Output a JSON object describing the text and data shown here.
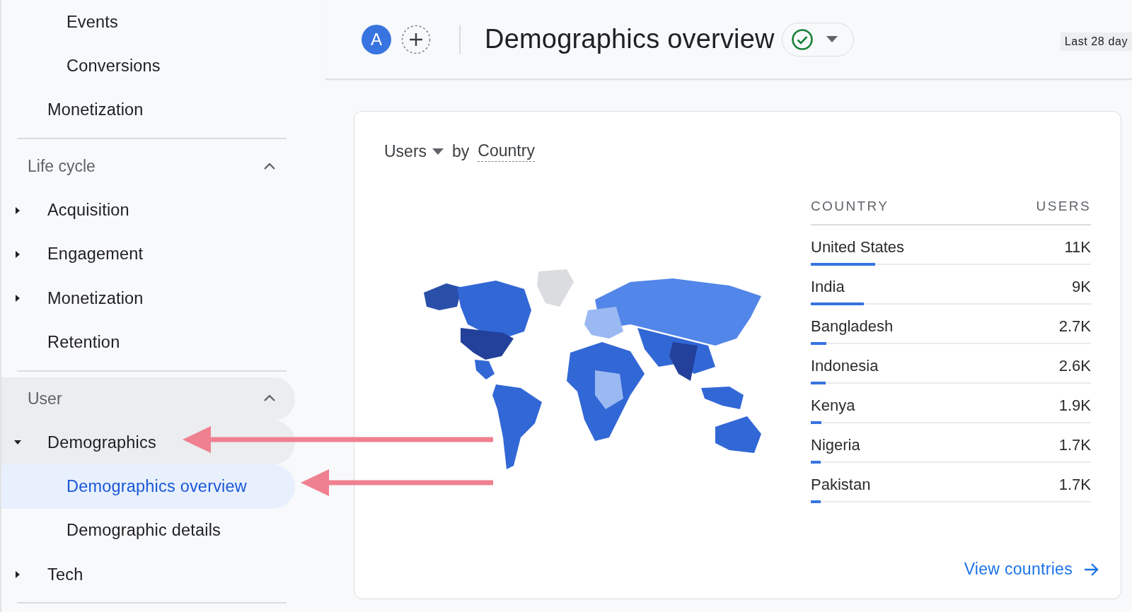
{
  "sidebar": {
    "items": [
      {
        "label": "Events",
        "kind": "child"
      },
      {
        "label": "Conversions",
        "kind": "child"
      },
      {
        "label": "Monetization",
        "kind": "item"
      }
    ],
    "sections": [
      {
        "title": "Life cycle",
        "expanded": true,
        "highlighted": false,
        "items": [
          {
            "label": "Acquisition",
            "expandable": true,
            "expanded": false,
            "highlighted": false
          },
          {
            "label": "Engagement",
            "expandable": true,
            "expanded": false,
            "highlighted": false
          },
          {
            "label": "Monetization",
            "expandable": true,
            "expanded": false,
            "highlighted": false
          },
          {
            "label": "Retention",
            "expandable": false,
            "highlighted": false
          }
        ]
      },
      {
        "title": "User",
        "expanded": true,
        "highlighted": true,
        "items": [
          {
            "label": "Demographics",
            "expandable": true,
            "expanded": true,
            "highlighted": true,
            "children": [
              {
                "label": "Demographics overview",
                "selected": true
              },
              {
                "label": "Demographic details",
                "selected": false
              }
            ]
          },
          {
            "label": "Tech",
            "expandable": true,
            "expanded": false,
            "highlighted": false
          }
        ]
      }
    ]
  },
  "header": {
    "avatar": "A",
    "title": "Demographics overview",
    "verified": true,
    "date_range": "Last 28 day"
  },
  "map_card": {
    "metric": "Users",
    "by": "by",
    "dimension": "Country",
    "columns": [
      "COUNTRY",
      "USERS"
    ],
    "rows": [
      {
        "country": "United States",
        "users": "11K",
        "level": 0.23
      },
      {
        "country": "India",
        "users": "9K",
        "level": 0.19
      },
      {
        "country": "Bangladesh",
        "users": "2.7K",
        "level": 0.055
      },
      {
        "country": "Indonesia",
        "users": "2.6K",
        "level": 0.053
      },
      {
        "country": "Kenya",
        "users": "1.9K",
        "level": 0.038
      },
      {
        "country": "Nigeria",
        "users": "1.7K",
        "level": 0.035
      },
      {
        "country": "Pakistan",
        "users": "1.7K",
        "level": 0.035
      }
    ],
    "link": "View countries"
  }
}
